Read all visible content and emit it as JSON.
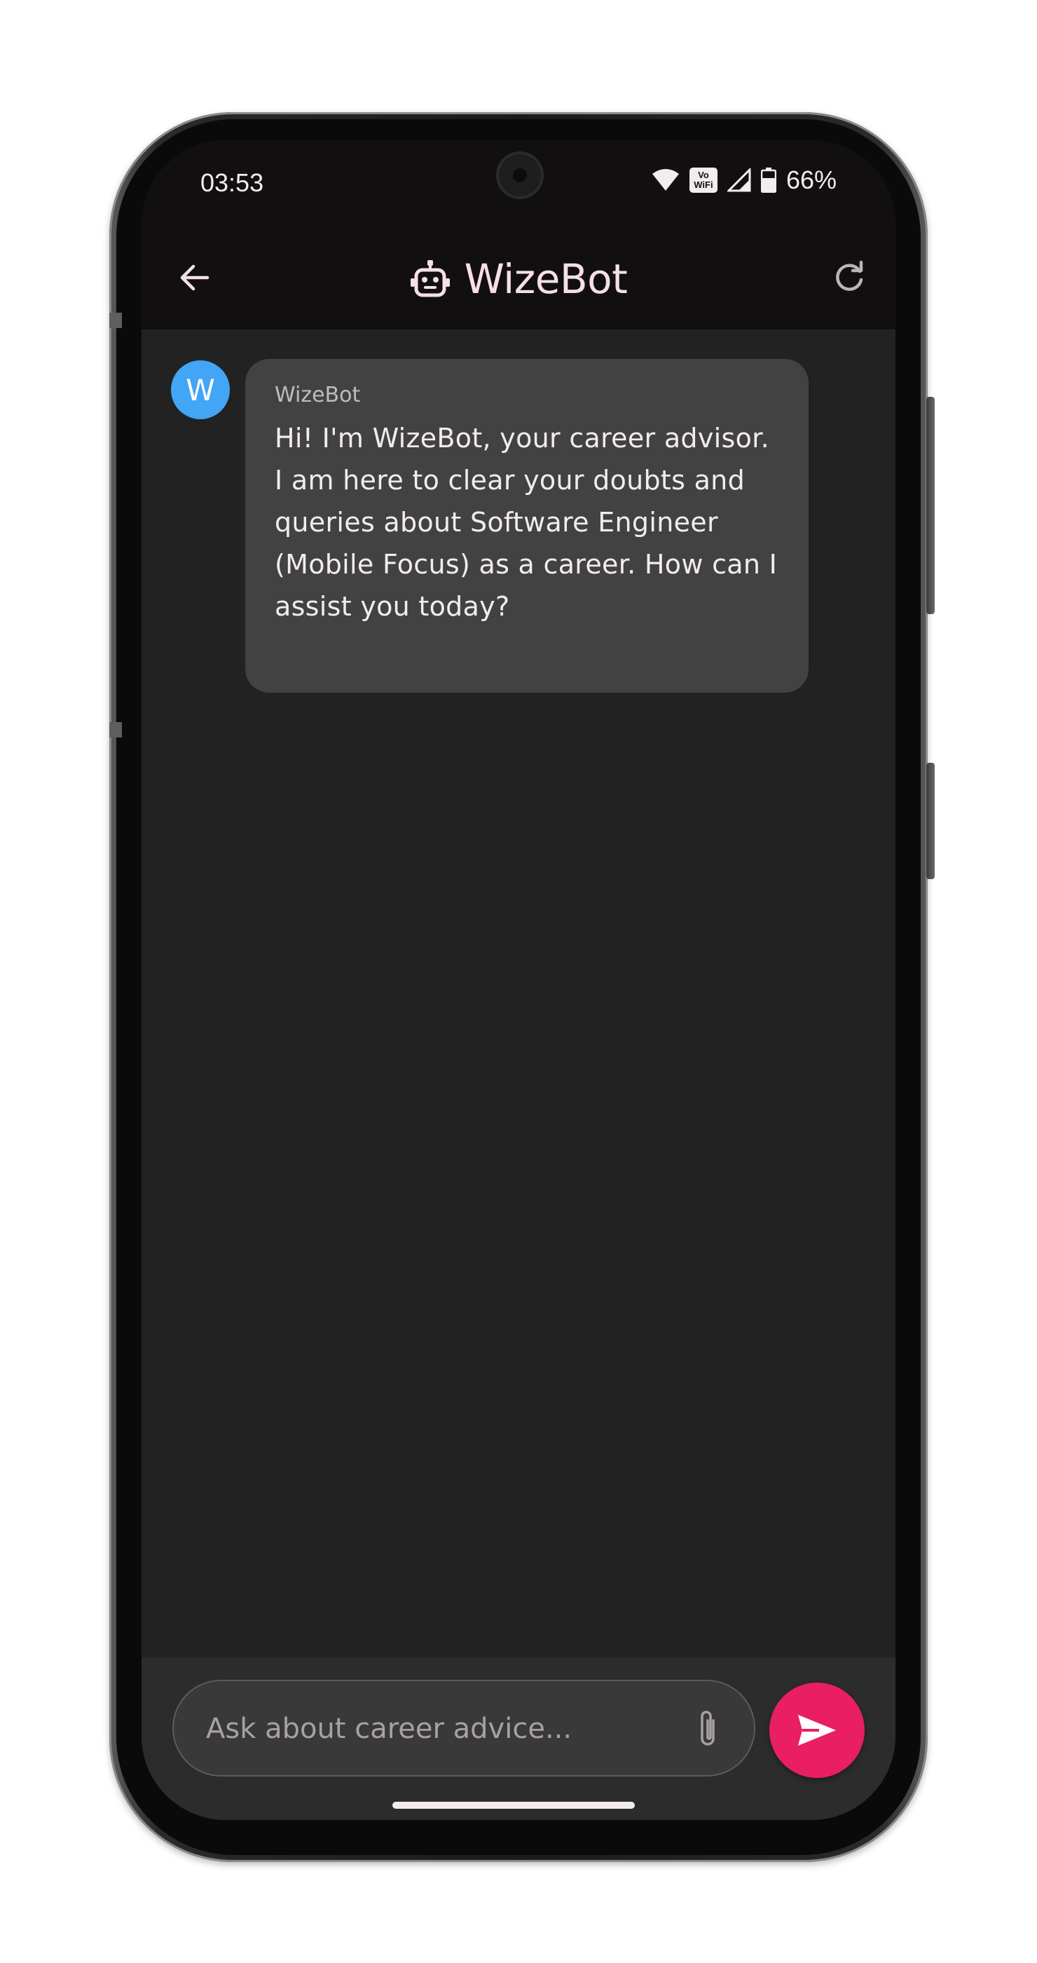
{
  "status_bar": {
    "time": "03:53",
    "battery": "66%",
    "vowifi_top": "Vo",
    "vowifi_bottom": "WiFi",
    "icons": [
      "wifi-icon",
      "vowifi-icon",
      "signal-icon",
      "battery-icon"
    ]
  },
  "app_bar": {
    "title": "WizeBot",
    "back_icon": "arrow-left-icon",
    "title_icon": "robot-icon",
    "refresh_icon": "refresh-icon"
  },
  "messages": [
    {
      "avatar_letter": "W",
      "sender": "WizeBot",
      "text": "Hi! I'm WizeBot, your career advisor. I am here to clear your doubts and queries about Software Engineer (Mobile Focus) as a career. How can I assist you today?"
    }
  ],
  "composer": {
    "placeholder": "Ask about career advice...",
    "attach_icon": "paperclip-icon",
    "send_icon": "send-icon"
  },
  "colors": {
    "app_bar_bg": "#120f10",
    "chat_bg": "#222222",
    "bubble_bg": "#424242",
    "avatar_bg": "#42a5f5",
    "send_button": "#e91e63",
    "title_text": "#f6e0e4"
  }
}
